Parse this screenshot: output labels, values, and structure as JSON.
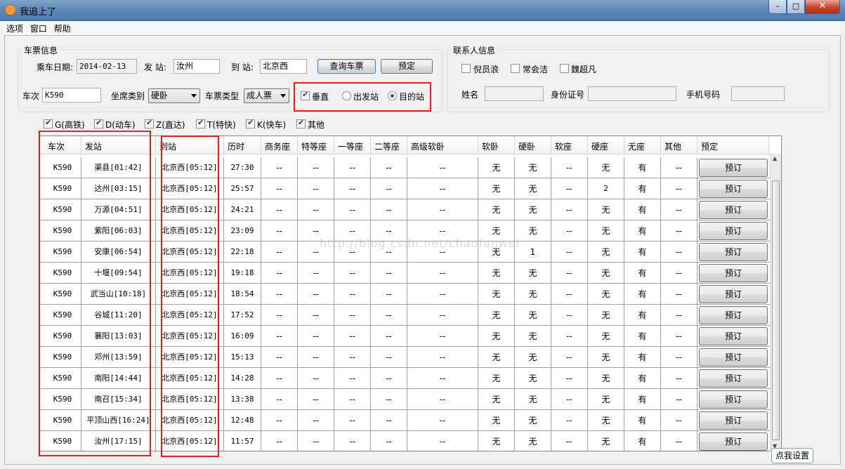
{
  "window": {
    "title": "我追上了",
    "min_label": "–",
    "max_label": "□",
    "close_label": "✕"
  },
  "menu": [
    "选项",
    "窗口",
    "帮助"
  ],
  "ticket_info": {
    "group_title": "车票信息",
    "date_label": "乘车日期:",
    "date_value": "2014-02-13",
    "from_label": "发 站:",
    "from_value": "汝州",
    "to_label": "到 站:",
    "to_value": "北京西",
    "query_button": "查询车票",
    "reserve_button": "预定",
    "train_label": "车次",
    "train_value": "K590",
    "seat_type_label": "坐席类别",
    "seat_type_value": "硬卧",
    "ticket_type_label": "车票类型",
    "ticket_type_value": "成人票",
    "vertical_label": "垂直",
    "radio_from_label": "出发站",
    "radio_to_label": "目的站"
  },
  "contact_info": {
    "group_title": "联系人信息",
    "people": [
      "倪员浪",
      "常会洁",
      "魏超凡"
    ],
    "name_label": "姓名",
    "id_label": "身份证号",
    "phone_label": "手机号码"
  },
  "filters": [
    {
      "label": "G(高铁)",
      "checked": true
    },
    {
      "label": "D(动车)",
      "checked": true
    },
    {
      "label": "Z(直达)",
      "checked": true
    },
    {
      "label": "T(特快)",
      "checked": true
    },
    {
      "label": "K(快车)",
      "checked": true
    },
    {
      "label": "其他",
      "checked": true
    }
  ],
  "table": {
    "headers": [
      "车次",
      "发站",
      "到站",
      "历时",
      "商务座",
      "特等座",
      "一等座",
      "二等座",
      "高级软卧",
      "软卧",
      "硬卧",
      "软座",
      "硬座",
      "无座",
      "其他",
      "预定"
    ],
    "button_label": "预订",
    "rows": [
      [
        "K590",
        "渠县[01:42]",
        "北京西[05:12]",
        "27:30",
        "--",
        "--",
        "--",
        "--",
        "--",
        "无",
        "无",
        "--",
        "无",
        "有",
        "--"
      ],
      [
        "K590",
        "达州[03:15]",
        "北京西[05:12]",
        "25:57",
        "--",
        "--",
        "--",
        "--",
        "--",
        "无",
        "无",
        "--",
        "2",
        "有",
        "--"
      ],
      [
        "K590",
        "万源[04:51]",
        "北京西[05:12]",
        "24:21",
        "--",
        "--",
        "--",
        "--",
        "--",
        "无",
        "无",
        "--",
        "无",
        "有",
        "--"
      ],
      [
        "K590",
        "紫阳[06:03]",
        "北京西[05:12]",
        "23:09",
        "--",
        "--",
        "--",
        "--",
        "--",
        "无",
        "无",
        "--",
        "无",
        "有",
        "--"
      ],
      [
        "K590",
        "安康[06:54]",
        "北京西[05:12]",
        "22:18",
        "--",
        "--",
        "--",
        "--",
        "--",
        "无",
        "1",
        "--",
        "无",
        "有",
        "--"
      ],
      [
        "K590",
        "十堰[09:54]",
        "北京西[05:12]",
        "19:18",
        "--",
        "--",
        "--",
        "--",
        "--",
        "无",
        "无",
        "--",
        "无",
        "有",
        "--"
      ],
      [
        "K590",
        "武当山[10:18]",
        "北京西[05:12]",
        "18:54",
        "--",
        "--",
        "--",
        "--",
        "--",
        "无",
        "无",
        "--",
        "无",
        "有",
        "--"
      ],
      [
        "K590",
        "谷城[11:20]",
        "北京西[05:12]",
        "17:52",
        "--",
        "--",
        "--",
        "--",
        "--",
        "无",
        "无",
        "--",
        "无",
        "有",
        "--"
      ],
      [
        "K590",
        "襄阳[13:03]",
        "北京西[05:12]",
        "16:09",
        "--",
        "--",
        "--",
        "--",
        "--",
        "无",
        "无",
        "--",
        "无",
        "有",
        "--"
      ],
      [
        "K590",
        "邓州[13:59]",
        "北京西[05:12]",
        "15:13",
        "--",
        "--",
        "--",
        "--",
        "--",
        "无",
        "无",
        "--",
        "无",
        "有",
        "--"
      ],
      [
        "K590",
        "南阳[14:44]",
        "北京西[05:12]",
        "14:28",
        "--",
        "--",
        "--",
        "--",
        "--",
        "无",
        "无",
        "--",
        "无",
        "有",
        "--"
      ],
      [
        "K590",
        "南召[15:34]",
        "北京西[05:12]",
        "13:38",
        "--",
        "--",
        "--",
        "--",
        "--",
        "无",
        "无",
        "--",
        "无",
        "有",
        "--"
      ],
      [
        "K590",
        "平顶山西[16:24]",
        "北京西[05:12]",
        "12:48",
        "--",
        "--",
        "--",
        "--",
        "--",
        "无",
        "无",
        "--",
        "无",
        "有",
        "--"
      ],
      [
        "K590",
        "汝州[17:15]",
        "北京西[05:12]",
        "11:57",
        "--",
        "--",
        "--",
        "--",
        "--",
        "无",
        "无",
        "--",
        "无",
        "有",
        "--"
      ]
    ]
  },
  "watermark": "http://blog.csdn.net/chaofanwei",
  "tooltip": "点我设置",
  "colors": {
    "highlight": "#e02020",
    "titlebar": "#5d87b8"
  }
}
